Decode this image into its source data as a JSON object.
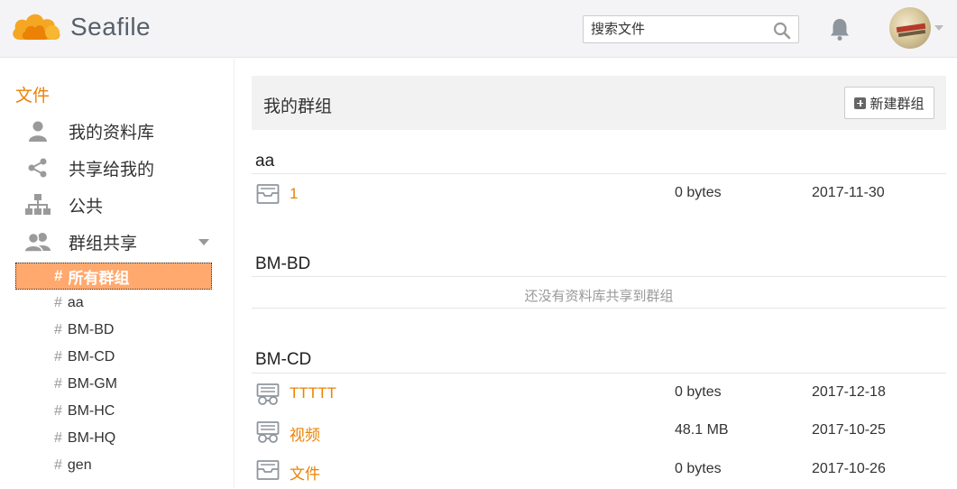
{
  "header": {
    "brand": "Seafile",
    "search_placeholder": "搜索文件",
    "icons": {
      "search": "search-icon",
      "notifications": "bell-icon",
      "user": "avatar"
    }
  },
  "sidebar": {
    "heading": "文件",
    "nav": [
      {
        "label": "我的资料库",
        "icon": "user-icon"
      },
      {
        "label": "共享给我的",
        "icon": "share-icon"
      },
      {
        "label": "公共",
        "icon": "sitemap-icon"
      },
      {
        "label": "群组共享",
        "icon": "group-icon"
      }
    ],
    "groups_hash": "#",
    "groups": [
      {
        "label": "所有群组",
        "active": true
      },
      {
        "label": "aa"
      },
      {
        "label": "BM-BD"
      },
      {
        "label": "BM-CD"
      },
      {
        "label": "BM-GM"
      },
      {
        "label": "BM-HC"
      },
      {
        "label": "BM-HQ"
      },
      {
        "label": "gen"
      }
    ]
  },
  "main": {
    "title": "我的群组",
    "new_group_label": "新建群组",
    "sections": [
      {
        "name": "aa",
        "libraries": [
          {
            "name": "1",
            "size": "0 bytes",
            "date": "2017-11-30",
            "icon": "library-icon"
          }
        ]
      },
      {
        "name": "BM-BD",
        "empty_text": "还没有资料库共享到群组",
        "libraries": []
      },
      {
        "name": "BM-CD",
        "libraries": [
          {
            "name": "TTTTT",
            "size": "0 bytes",
            "date": "2017-12-18",
            "icon": "library-readonly-icon"
          },
          {
            "name": "视频",
            "size": "48.1 MB",
            "date": "2017-10-25",
            "icon": "library-readonly-icon"
          },
          {
            "name": "文件",
            "size": "0 bytes",
            "date": "2017-10-26",
            "icon": "library-icon"
          }
        ]
      }
    ]
  },
  "colors": {
    "accent": "#eb8205",
    "active_bg": "#ffa96e",
    "header_bg": "#f4f4f7"
  }
}
